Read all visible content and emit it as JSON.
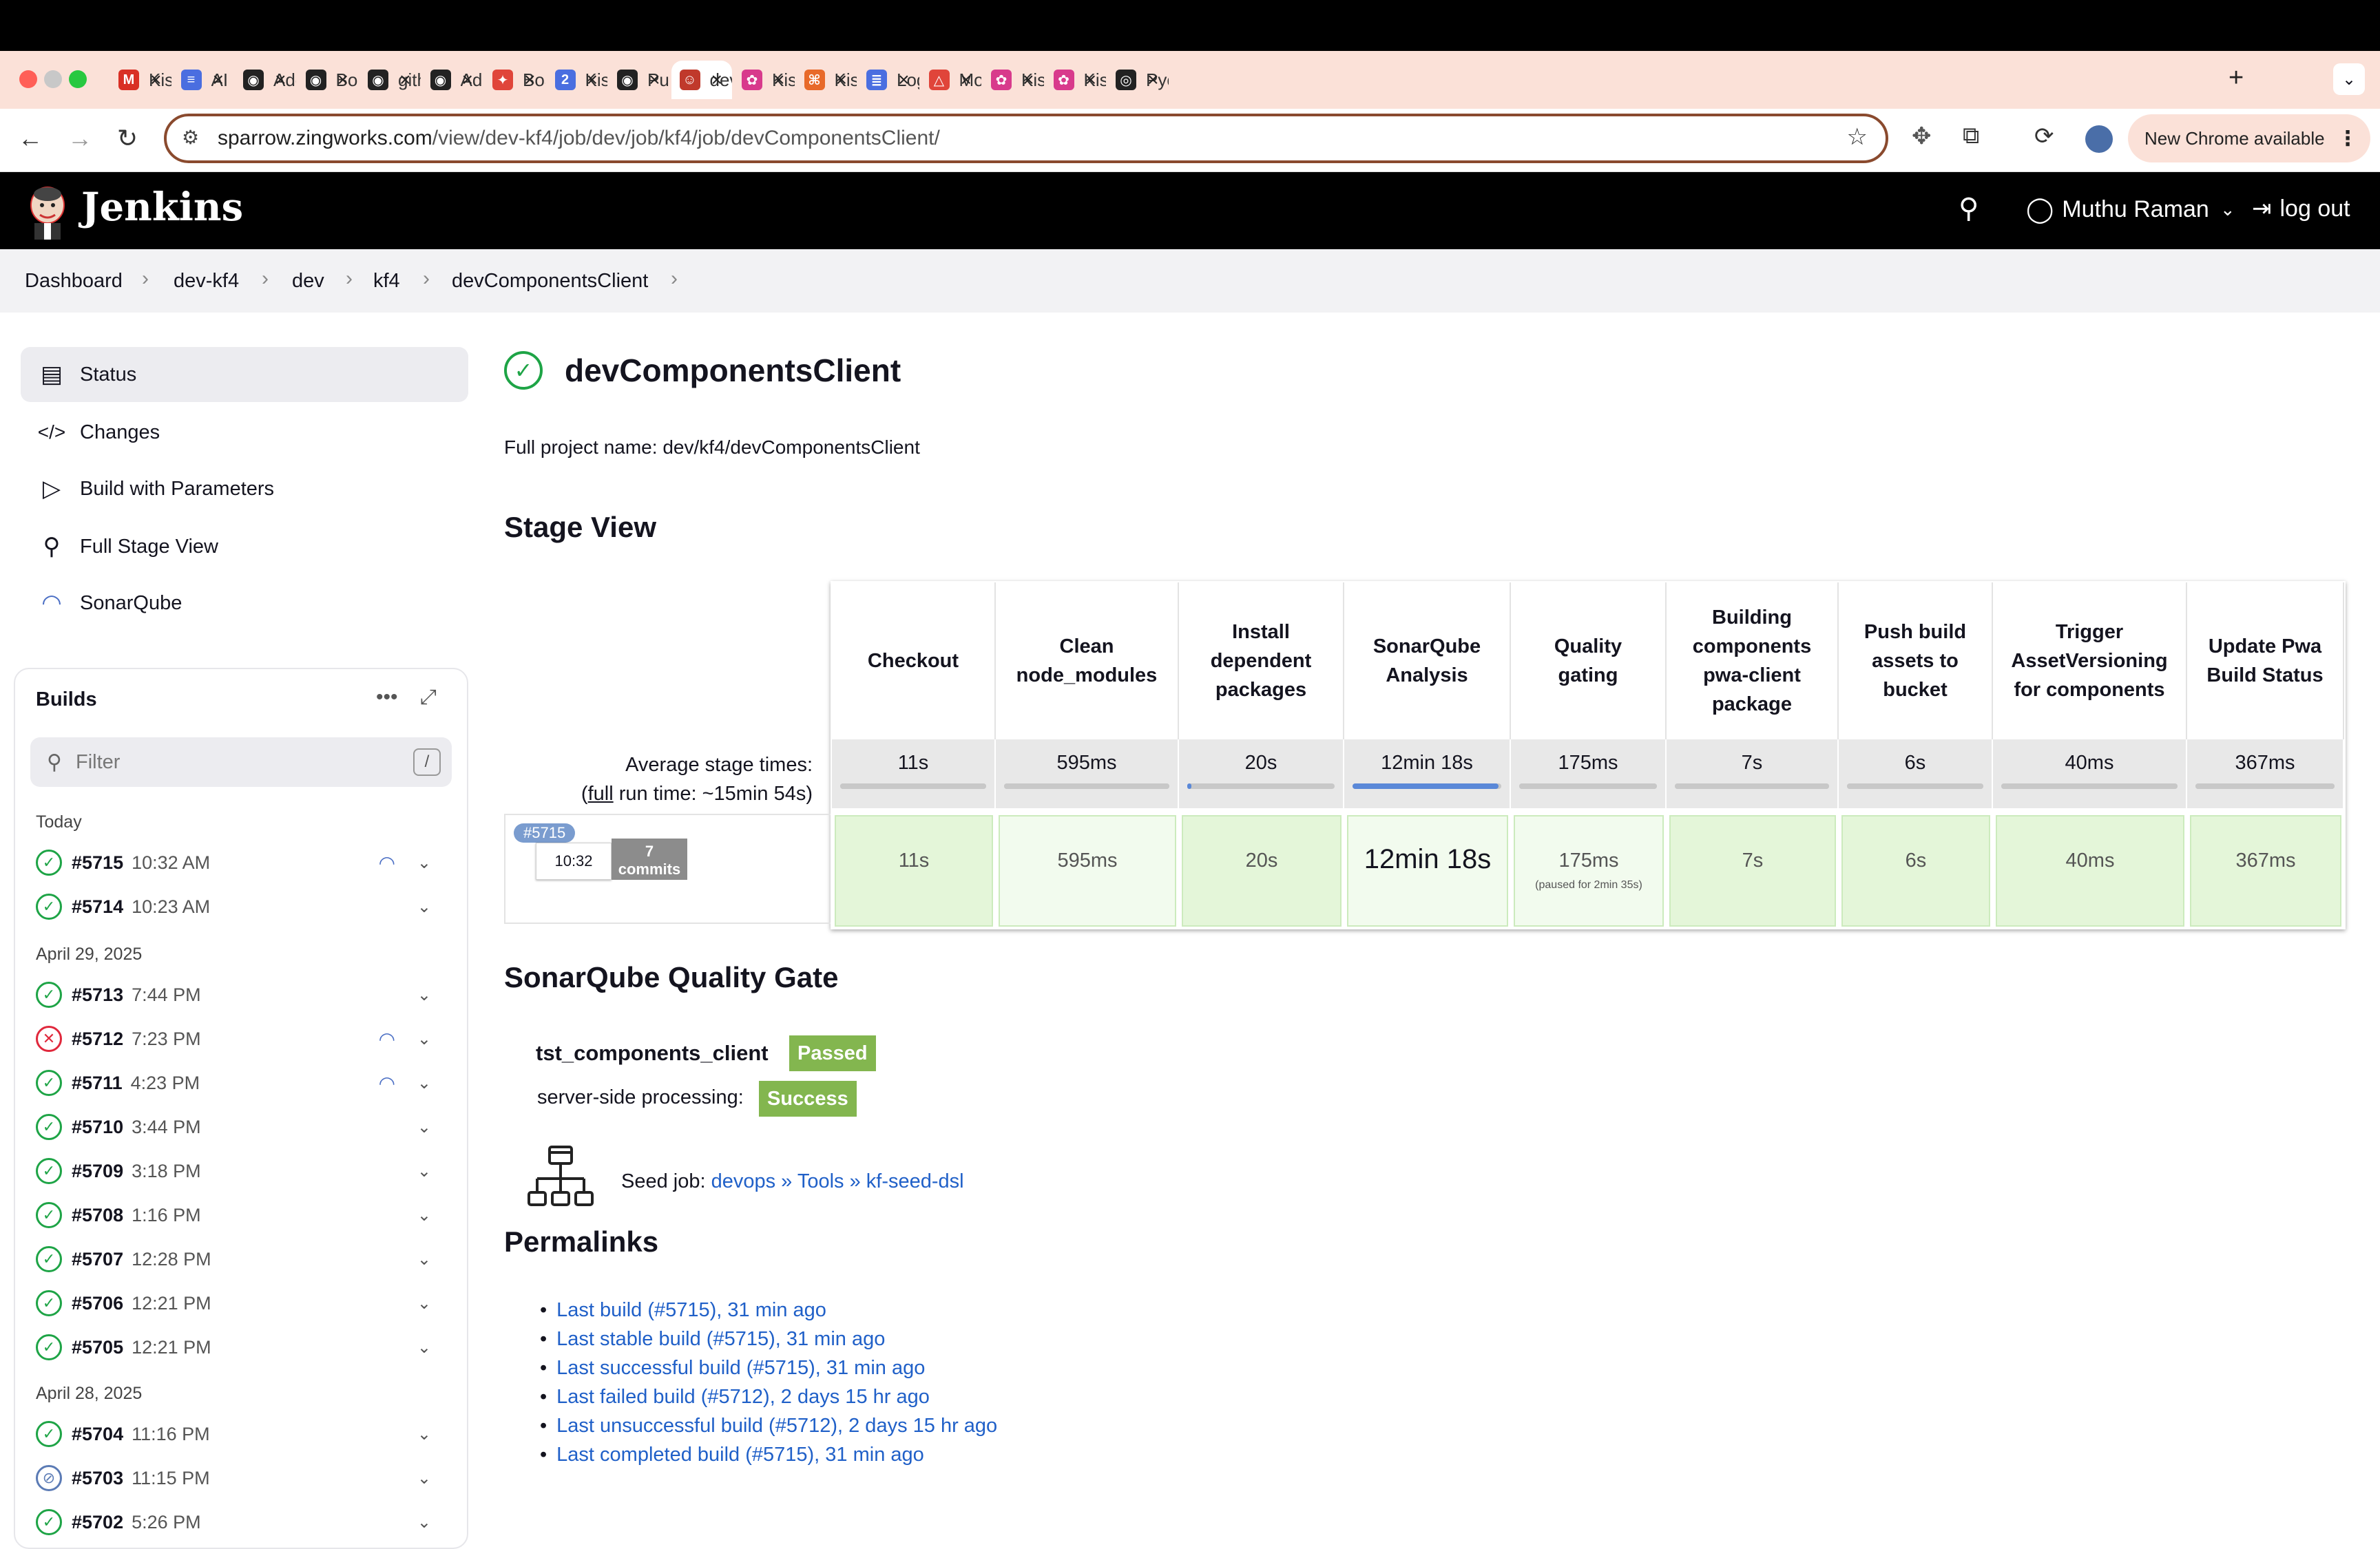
{
  "browser": {
    "tabs": [
      {
        "title": "Kis",
        "color": "#d93025",
        "glyph": "M"
      },
      {
        "title": "AI b",
        "color": "#4a6ee0",
        "glyph": "≡"
      },
      {
        "title": "Add",
        "color": "#222222",
        "glyph": "◉"
      },
      {
        "title": "Boa",
        "color": "#222222",
        "glyph": "◉"
      },
      {
        "title": "gith",
        "color": "#222222",
        "glyph": "◉"
      },
      {
        "title": "Add",
        "color": "#222222",
        "glyph": "◉"
      },
      {
        "title": "Boa",
        "color": "#e0453a",
        "glyph": "✦"
      },
      {
        "title": "Kis",
        "color": "#4a6ee0",
        "glyph": "2"
      },
      {
        "title": "Pull",
        "color": "#222222",
        "glyph": "◉"
      },
      {
        "title": "dev",
        "color": "#c0392b",
        "glyph": "☺"
      },
      {
        "title": "Kis",
        "color": "#d83a8c",
        "glyph": "✿"
      },
      {
        "title": "Kis",
        "color": "#e86a2a",
        "glyph": "⌘"
      },
      {
        "title": "Log",
        "color": "#4a6ee0",
        "glyph": "≣"
      },
      {
        "title": "Mo",
        "color": "#e0453a",
        "glyph": "△"
      },
      {
        "title": "Kis",
        "color": "#d83a8c",
        "glyph": "✿"
      },
      {
        "title": "Kis",
        "color": "#d83a8c",
        "glyph": "✿"
      },
      {
        "title": "Pyc",
        "color": "#222222",
        "glyph": "◎"
      }
    ],
    "new_tab": "+",
    "url_host": "sparrow.zingworks.com",
    "url_path": "/view/dev-kf4/job/dev/job/kf4/job/devComponentsClient/",
    "update_label": "New Chrome available"
  },
  "jenkins": {
    "title": "Jenkins",
    "user": "Muthu Raman",
    "logout": "log out"
  },
  "breadcrumb": [
    "Dashboard",
    "dev-kf4",
    "dev",
    "kf4",
    "devComponentsClient"
  ],
  "sidebar": {
    "items": [
      {
        "label": "Status",
        "icon": "document-icon",
        "glyph": "▤"
      },
      {
        "label": "Changes",
        "icon": "code-icon",
        "glyph": "</>"
      },
      {
        "label": "Build with Parameters",
        "icon": "play-icon",
        "glyph": "▷"
      },
      {
        "label": "Full Stage View",
        "icon": "search-icon",
        "glyph": "⚲"
      },
      {
        "label": "SonarQube",
        "icon": "sonarqube-icon",
        "glyph": "◠"
      }
    ]
  },
  "builds": {
    "title": "Builds",
    "filter_placeholder": "Filter",
    "filter_shortcut": "/",
    "groups": [
      {
        "label": "Today",
        "rows": [
          {
            "num": "#5715",
            "time": "10:32 AM",
            "status": "success",
            "sonar": true
          },
          {
            "num": "#5714",
            "time": "10:23 AM",
            "status": "success",
            "sonar": false
          }
        ]
      },
      {
        "label": "April 29, 2025",
        "rows": [
          {
            "num": "#5713",
            "time": "7:44 PM",
            "status": "success",
            "sonar": false
          },
          {
            "num": "#5712",
            "time": "7:23 PM",
            "status": "failure",
            "sonar": true
          },
          {
            "num": "#5711",
            "time": "4:23 PM",
            "status": "success",
            "sonar": true
          },
          {
            "num": "#5710",
            "time": "3:44 PM",
            "status": "success",
            "sonar": false
          },
          {
            "num": "#5709",
            "time": "3:18 PM",
            "status": "success",
            "sonar": false
          },
          {
            "num": "#5708",
            "time": "1:16 PM",
            "status": "success",
            "sonar": false
          },
          {
            "num": "#5707",
            "time": "12:28 PM",
            "status": "success",
            "sonar": false
          },
          {
            "num": "#5706",
            "time": "12:21 PM",
            "status": "success",
            "sonar": false
          },
          {
            "num": "#5705",
            "time": "12:21 PM",
            "status": "success",
            "sonar": false
          }
        ]
      },
      {
        "label": "April 28, 2025",
        "rows": [
          {
            "num": "#5704",
            "time": "11:16 PM",
            "status": "success",
            "sonar": false
          },
          {
            "num": "#5703",
            "time": "11:15 PM",
            "status": "aborted",
            "sonar": false
          },
          {
            "num": "#5702",
            "time": "5:26 PM",
            "status": "success",
            "sonar": false
          }
        ]
      }
    ]
  },
  "project": {
    "name": "devComponentsClient",
    "full_name": "Full project name: dev/kf4/devComponentsClient"
  },
  "stage_view": {
    "title": "Stage View",
    "avg_label": "Average stage times:",
    "full_prefix": "(",
    "full_word": "full",
    "full_rest": " run time: ~15min 54s)",
    "stages": [
      {
        "name": "Checkout",
        "avg": "11s",
        "run": "11s",
        "progress": 1.0
      },
      {
        "name": "Clean node_modules",
        "avg": "595ms",
        "run": "595ms",
        "progress": 1.0
      },
      {
        "name": "Install dependent packages",
        "avg": "20s",
        "run": "20s",
        "progress": 0.03
      },
      {
        "name": "SonarQube Analysis",
        "avg": "12min 18s",
        "run": "12min 18s",
        "progress": 0.98
      },
      {
        "name": "Quality gating",
        "avg": "175ms",
        "run": "175ms",
        "progress": 1.0,
        "note": "(paused for 2min 35s)"
      },
      {
        "name": "Building components pwa-client package",
        "avg": "7s",
        "run": "7s",
        "progress": 1.0
      },
      {
        "name": "Push build assets to bucket",
        "avg": "6s",
        "run": "6s",
        "progress": 1.0
      },
      {
        "name": "Trigger AssetVersioning for components",
        "avg": "40ms",
        "run": "40ms",
        "progress": 1.0
      },
      {
        "name": "Update Pwa Build Status",
        "avg": "367ms",
        "run": "367ms",
        "progress": 1.0
      }
    ],
    "run": {
      "badge": "#5715",
      "time": "10:32",
      "commits_count": "7",
      "commits_label": "commits"
    }
  },
  "sonar": {
    "title": "SonarQube Quality Gate",
    "project": "tst_components_client",
    "status": "Passed",
    "ssp_label": "server-side processing:",
    "ssp_status": "Success"
  },
  "seed": {
    "label": "Seed job: ",
    "link": "devops » Tools » kf-seed-dsl"
  },
  "permalinks": {
    "title": "Permalinks",
    "links": [
      "Last build (#5715), 31 min ago",
      "Last stable build (#5715), 31 min ago",
      "Last successful build (#5715), 31 min ago",
      "Last failed build (#5712), 2 days 15 hr ago",
      "Last unsuccessful build (#5712), 2 days 15 hr ago",
      "Last completed build (#5715), 31 min ago"
    ]
  }
}
